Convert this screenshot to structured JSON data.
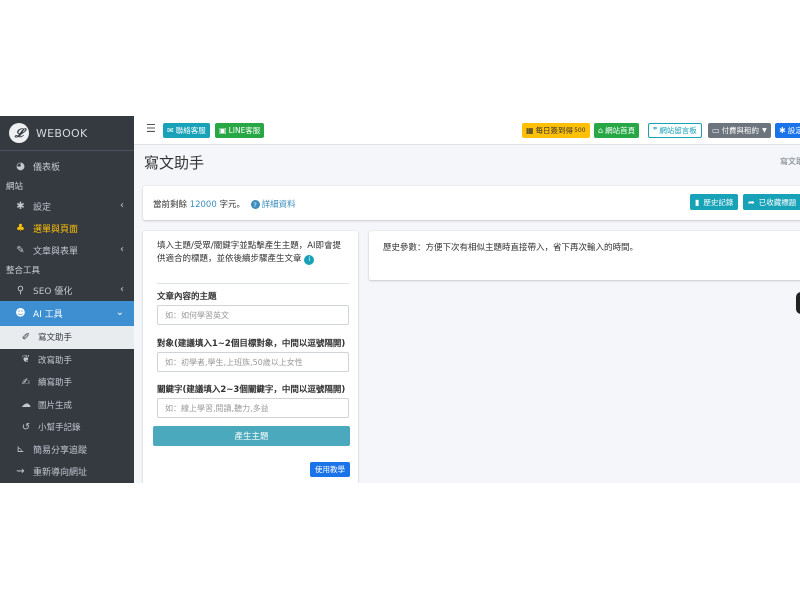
{
  "brand": {
    "logo_letter": "𝓛",
    "name": "WEBOOK"
  },
  "sidebar": {
    "dashboard": "儀表板",
    "section_site": "網站",
    "settings": "設定",
    "menu_pages": "選單與頁面",
    "articles_forms": "文章與表單",
    "section_tools": "整合工具",
    "seo": "SEO 優化",
    "ai_tools": "AI 工具",
    "ai_sub": [
      {
        "label": "寫文助手",
        "icon": "pencil-icon",
        "active": true
      },
      {
        "label": "改寫助手",
        "icon": "feather-icon",
        "active": false
      },
      {
        "label": "續寫助手",
        "icon": "file-pen-icon",
        "active": false
      },
      {
        "label": "圖片生成",
        "icon": "image-gen-icon",
        "active": false
      },
      {
        "label": "小幫手記錄",
        "icon": "history-icon",
        "active": false
      }
    ],
    "share_tracking": "簡易分享追蹤",
    "redirect": "重新導向網址"
  },
  "topbar": {
    "contact": "聯絡客服",
    "line": "LINE客服",
    "daily": "每日簽到得",
    "daily_points": "500",
    "home": "網站首頁",
    "message": "網站留言板",
    "paid": "付費與租約",
    "settings": "設定"
  },
  "content": {
    "title": "寫文助手",
    "crumb": "寫文助",
    "remain_prefix": "當前剩餘 ",
    "remain_num": "12000",
    "remain_suffix": " 字元。",
    "detail_link": "詳細資料",
    "history_btn": "歷史記錄",
    "favorites_btn": "已收藏標題"
  },
  "form": {
    "desc": "填入主題/受眾/關鍵字並點擊產生主題，AI即會提供適合的標題，並依後續步驟產生文章",
    "label_topic": "文章內容的主題",
    "ph_topic": "如：如何學習英文",
    "label_audience": "對象(建議填入1~2個目標對象，中間以逗號隔開)",
    "ph_audience": "如：初學者,學生,上班族,50歲以上女性",
    "label_keywords": "關鍵字(建議填入2~3個關鍵字，中間以逗號隔開)",
    "ph_keywords": "如：線上學習,閱讀,聽力,多益",
    "generate": "產生主題",
    "tutorial": "使用教學"
  },
  "history": {
    "text": "歷史參數：方便下次有相似主題時直接帶入，省下再次輸入的時間。"
  },
  "colors": {
    "sidebar": "#343a40",
    "active": "#3d8fd1",
    "teal": "#17a2b8",
    "green": "#28a745",
    "yellow": "#ffc107",
    "primary": "#1a73e8"
  }
}
